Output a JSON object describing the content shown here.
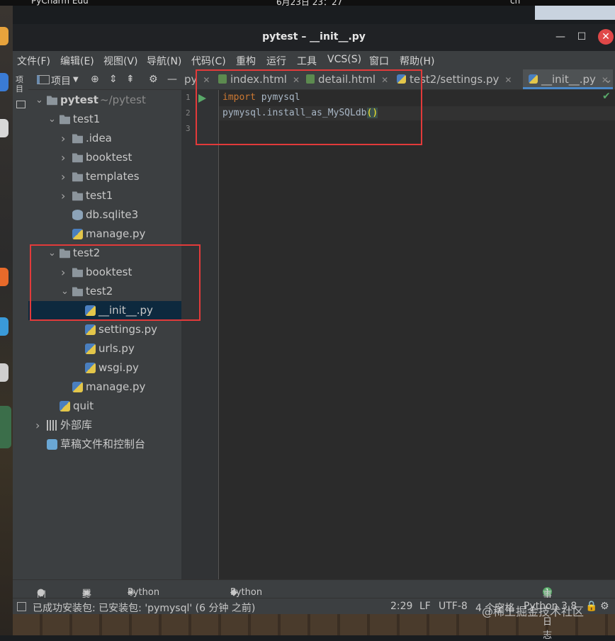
{
  "desktop": {
    "app_label": "PyCharm Edu",
    "clock": "6月23日 23：27",
    "lang": "cn"
  },
  "window": {
    "title": "pytest – __init__.py"
  },
  "menu": [
    "文件(F)",
    "编辑(E)",
    "视图(V)",
    "导航(N)",
    "代码(C)",
    "重构",
    "运行",
    "工具",
    "VCS(S)",
    "窗口",
    "帮助(H)"
  ],
  "left_strip": {
    "label": "项目"
  },
  "project_panel": {
    "header": "项目"
  },
  "tree": [
    {
      "label": "pytest",
      "hint": "~/pytest",
      "type": "folder",
      "depth": 0,
      "arrow": "down"
    },
    {
      "label": "test1",
      "type": "folder",
      "depth": 1,
      "arrow": "down"
    },
    {
      "label": ".idea",
      "type": "folder",
      "depth": 2,
      "arrow": "right"
    },
    {
      "label": "booktest",
      "type": "folder",
      "depth": 2,
      "arrow": "right"
    },
    {
      "label": "templates",
      "type": "folder",
      "depth": 2,
      "arrow": "right"
    },
    {
      "label": "test1",
      "type": "folder",
      "depth": 2,
      "arrow": "right"
    },
    {
      "label": "db.sqlite3",
      "type": "db",
      "depth": 2,
      "arrow": ""
    },
    {
      "label": "manage.py",
      "type": "py",
      "depth": 2,
      "arrow": ""
    },
    {
      "label": "test2",
      "type": "folder",
      "depth": 1,
      "arrow": "down"
    },
    {
      "label": "booktest",
      "type": "folder",
      "depth": 2,
      "arrow": "right"
    },
    {
      "label": "test2",
      "type": "folder",
      "depth": 2,
      "arrow": "down"
    },
    {
      "label": "__init__.py",
      "type": "py",
      "depth": 3,
      "arrow": "",
      "selected": true
    },
    {
      "label": "settings.py",
      "type": "py",
      "depth": 3,
      "arrow": ""
    },
    {
      "label": "urls.py",
      "type": "py",
      "depth": 3,
      "arrow": ""
    },
    {
      "label": "wsgi.py",
      "type": "py",
      "depth": 3,
      "arrow": ""
    },
    {
      "label": "manage.py",
      "type": "py",
      "depth": 2,
      "arrow": ""
    },
    {
      "label": "quit",
      "type": "py",
      "depth": 1,
      "arrow": ""
    },
    {
      "label": "外部库",
      "type": "lib",
      "depth": 0,
      "arrow": "right"
    },
    {
      "label": "草稿文件和控制台",
      "type": "scratch",
      "depth": 0,
      "arrow": ""
    }
  ],
  "tabs": [
    {
      "label": "py",
      "icon": ""
    },
    {
      "label": "index.html",
      "icon": "h"
    },
    {
      "label": "detail.html",
      "icon": "h"
    },
    {
      "label": "test2/settings.py",
      "icon": "p"
    },
    {
      "label": "__init__.py",
      "icon": "p",
      "active": true
    }
  ],
  "editor": {
    "line_numbers": [
      "1",
      "2",
      "3"
    ],
    "line1_kw": "import",
    "line1_rest": " pymysql",
    "line2_text": "pymysql.install_as_MySQLdb",
    "line2_parens": "()"
  },
  "bottom_tools": [
    {
      "label": "问题",
      "icon": "info-icon"
    },
    {
      "label": "终端",
      "icon": "terminal-icon"
    },
    {
      "label": "Python Packages",
      "icon": "packages-icon"
    },
    {
      "label": "Python 控制台",
      "icon": "python-console-icon"
    },
    {
      "label": "事件日志",
      "icon": "event-log-icon"
    }
  ],
  "event_log_count": "1",
  "status": {
    "message": "已成功安装包: 已安装包: 'pymysql' (6 分钟 之前)",
    "position": "2:29",
    "line_sep": "LF",
    "encoding": "UTF-8",
    "indent": "4 个空格",
    "interpreter": "Python 3.8"
  },
  "watermark": "@稀土掘金技术社区",
  "colors": {
    "highlight_box": "#e23a3a",
    "keyword": "#cc7832",
    "selection": "#0d293e"
  }
}
